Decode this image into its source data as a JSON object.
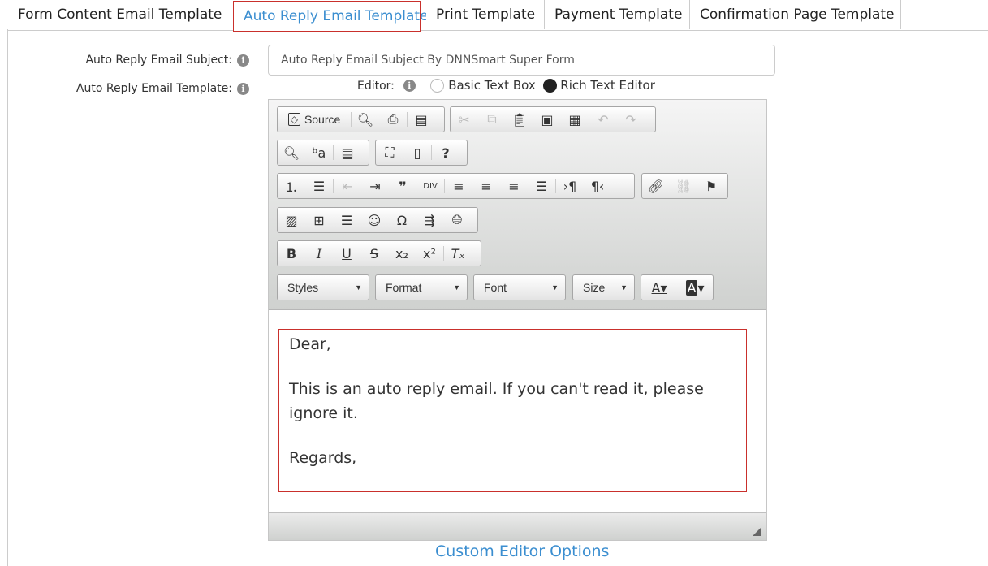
{
  "tabs": [
    {
      "label": "Form Content Email Template"
    },
    {
      "label": "Auto Reply Email Template"
    },
    {
      "label": "Print Template"
    },
    {
      "label": "Payment Template"
    },
    {
      "label": "Confirmation Page Template"
    }
  ],
  "form": {
    "subject_label": "Auto Reply Email Subject:",
    "subject_value": "Auto Reply Email Subject By DNNSmart Super Form",
    "template_label": "Auto Reply Email Template:",
    "editor_label": "Editor:",
    "radio_basic": "Basic Text Box",
    "radio_rich": "Rich Text Editor",
    "info_glyph": "i"
  },
  "toolbar": {
    "source": "Source",
    "styles": "Styles",
    "format": "Format",
    "font": "Font",
    "size": "Size"
  },
  "content": {
    "line1": "Dear,",
    "line2": "This is an auto reply email. If you can't read it, please ignore it.",
    "line3": "Regards,"
  },
  "footer": {
    "link": "Custom Editor Options"
  },
  "colors": {
    "accent": "#3b8ed0",
    "active_border": "#c9302c"
  }
}
